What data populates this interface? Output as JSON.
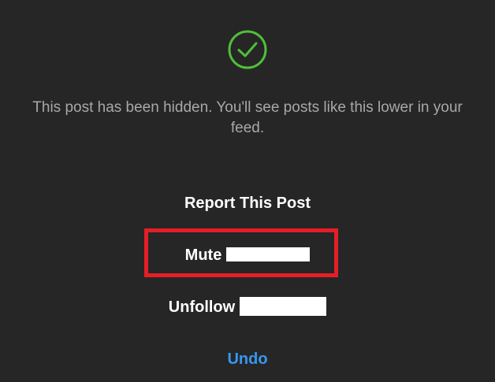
{
  "icon": {
    "name": "check-circle-icon",
    "color": "#4fbf3a"
  },
  "message": "This post has been hidden. You'll see posts like this lower in your feed.",
  "actions": {
    "report": "Report This Post",
    "mute": "Mute",
    "unfollow": "Unfollow",
    "undo": "Undo"
  },
  "colors": {
    "background": "#262626",
    "message_text": "#a8a8a8",
    "action_text": "#ffffff",
    "undo_link": "#3897f0",
    "highlight_border": "#e41e26"
  }
}
